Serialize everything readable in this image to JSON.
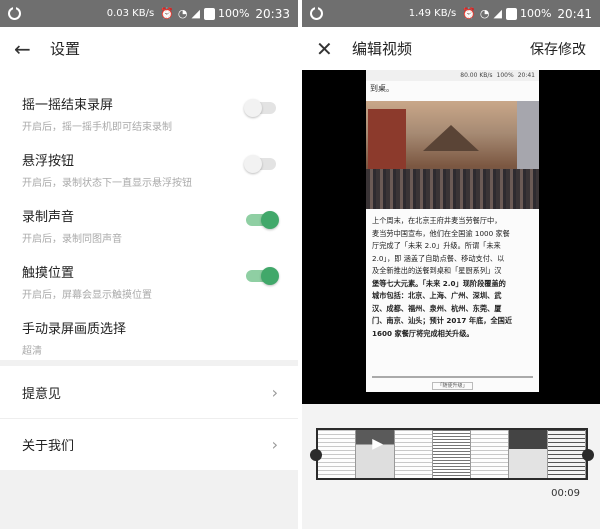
{
  "left": {
    "status": {
      "speed": "0.03 KB/s",
      "battery": "100%",
      "time": "20:33"
    },
    "header": {
      "back_icon": "arrow-left-icon",
      "title": "设置"
    },
    "toggles": [
      {
        "title": "摇一摇结束录屏",
        "subtitle": "开启后，摇一摇手机即可结束录制",
        "on": false
      },
      {
        "title": "悬浮按钮",
        "subtitle": "开启后，录制状态下一直显示悬浮按钮",
        "on": false
      },
      {
        "title": "录制声音",
        "subtitle": "开启后，录制同图声音",
        "on": true
      },
      {
        "title": "触摸位置",
        "subtitle": "开启后，屏幕会显示触摸位置",
        "on": true
      }
    ],
    "quality": {
      "title": "手动录屏画质选择",
      "value": "超清"
    },
    "links": [
      {
        "label": "提意见"
      },
      {
        "label": "关于我们"
      }
    ]
  },
  "right": {
    "status": {
      "speed": "1.49 KB/s",
      "battery": "100%",
      "time": "20:41"
    },
    "header": {
      "close_icon": "close-icon",
      "title": "编辑视频",
      "save_label": "保存修改"
    },
    "frame": {
      "status": {
        "speed": "80.00 KB/s",
        "battery": "100%",
        "time": "20:41"
      },
      "intro": "到桌。",
      "body_lines": [
        "上个周末，在北京王府井麦当劳餐厅中，",
        "麦当劳中国宣布，他们在全国逾 1000 家餐",
        "厅完成了「未来 2.0」升级。所谓「未来",
        "2.0」，即 涵盖了自助点餐、移动支付、以",
        "及全新推出的送餐到桌和「星厨系列」汉",
        "堡等七大元素。「未来 2.0」现阶段覆盖的",
        "城市包括：北京、上海、广州、深圳、武",
        "汉、成都、福州、泉州、杭州、东莞、厦",
        "门、南京、汕头；预计 2017 年底，全国近",
        "1600 家餐厅将完成相关升级。"
      ],
      "caption": "「随便升级」"
    },
    "duration": "00:09"
  }
}
